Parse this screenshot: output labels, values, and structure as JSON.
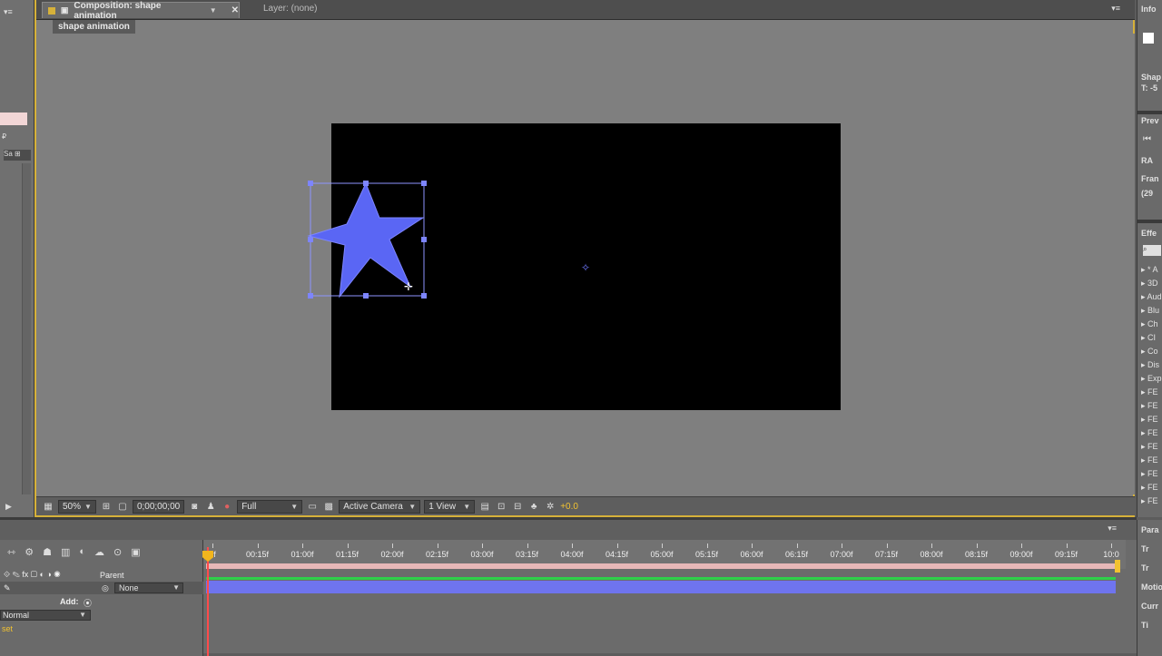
{
  "composition_panel": {
    "active_tab": "Composition: shape animation",
    "inactive_tab": "Layer: (none)",
    "breadcrumb": "shape animation"
  },
  "viewer_toolbar": {
    "zoom": "50%",
    "timecode": "0;00;00;00",
    "resolution": "Full",
    "camera": "Active Camera",
    "views": "1 View",
    "exposure": "+0.0"
  },
  "right_panel": {
    "info_label": "Info",
    "shape_label": "Shap",
    "shape_value": "T: -5",
    "preview_label": "Prev",
    "ram_label": "RA",
    "frame_label": "Fran",
    "frame_value": "(29",
    "effects_label": "Effe",
    "effects": [
      "* A",
      "3D",
      "Aud",
      "Blu",
      "Ch",
      "CI",
      "Co",
      "Dis",
      "Exp",
      "FE",
      "FE",
      "FE",
      "FE",
      "FE",
      "FE",
      "FE",
      "FE",
      "FE"
    ]
  },
  "timeline": {
    "parent_label": "Parent",
    "parent_value": "None",
    "add_label": "Add:",
    "blend_mode": "Normal",
    "offset_label": "set",
    "ruler": [
      "0f",
      "00:15f",
      "01:00f",
      "01:15f",
      "02:00f",
      "02:15f",
      "03:00f",
      "03:15f",
      "04:00f",
      "04:15f",
      "05:00f",
      "05:15f",
      "06:00f",
      "06:15f",
      "07:00f",
      "07:15f",
      "08:00f",
      "08:15f",
      "09:00f",
      "09:15f",
      "10:0"
    ],
    "right_labels": [
      "Para",
      "Tr",
      "Tr",
      "Motio",
      "Curr",
      "Ti"
    ]
  },
  "colors": {
    "accent": "#d6b13a",
    "shape_fill": "#5a66f4",
    "layer_bar": "#6f74ee",
    "cti": "#ff4b4b"
  }
}
